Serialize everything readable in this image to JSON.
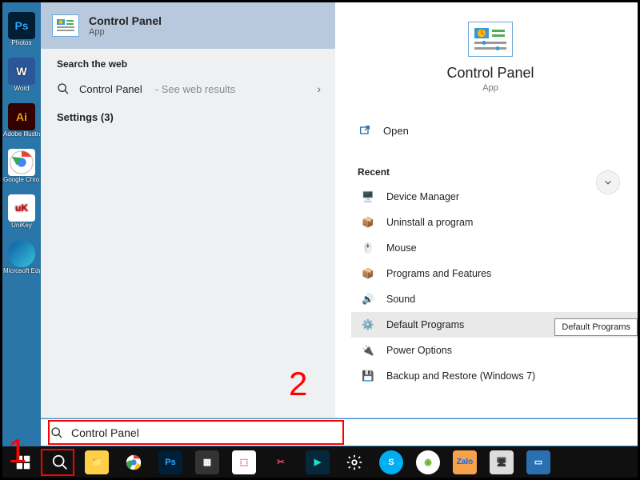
{
  "desktop": {
    "icons": [
      {
        "label": "Photos",
        "bg": "#001e36",
        "fg": "#31a8ff",
        "txt": "Ps"
      },
      {
        "label": "Word",
        "bg": "#2b579a",
        "fg": "#fff",
        "txt": "W"
      },
      {
        "label": "Adobe Illustrator",
        "bg": "#330000",
        "fg": "#ff9a00",
        "txt": "Ai"
      },
      {
        "label": "Google Chrome",
        "bg": "#fff",
        "fg": "#000",
        "txt": ""
      },
      {
        "label": "UniKey",
        "bg": "#fff",
        "fg": "#d00",
        "txt": "uK"
      },
      {
        "label": "Microsoft Edge",
        "bg": "#0f6cbd",
        "fg": "#fff",
        "txt": ""
      }
    ]
  },
  "search": {
    "best": {
      "title": "Control Panel",
      "subtitle": "App"
    },
    "web_header": "Search the web",
    "web_item": {
      "label": "Control Panel",
      "suffix": "- See web results"
    },
    "settings_label": "Settings (3)",
    "annotation2": "2",
    "query": "Control Panel"
  },
  "detail": {
    "title": "Control Panel",
    "subtitle": "App",
    "open": "Open",
    "recent_header": "Recent",
    "recent": [
      "Device Manager",
      "Uninstall a program",
      "Mouse",
      "Programs and Features",
      "Sound",
      "Default Programs",
      "Power Options",
      "Backup and Restore (Windows 7)"
    ],
    "tooltip": "Default Programs"
  },
  "annotation1": "1",
  "taskbar": {
    "items": [
      {
        "name": "start"
      },
      {
        "name": "search"
      },
      {
        "name": "explorer"
      },
      {
        "name": "chrome"
      },
      {
        "name": "photoshop"
      },
      {
        "name": "calculator"
      },
      {
        "name": "app1"
      },
      {
        "name": "snip"
      },
      {
        "name": "filmora"
      },
      {
        "name": "settings"
      },
      {
        "name": "skype"
      },
      {
        "name": "coccoc"
      },
      {
        "name": "zalo"
      },
      {
        "name": "pc"
      },
      {
        "name": "id"
      }
    ]
  }
}
